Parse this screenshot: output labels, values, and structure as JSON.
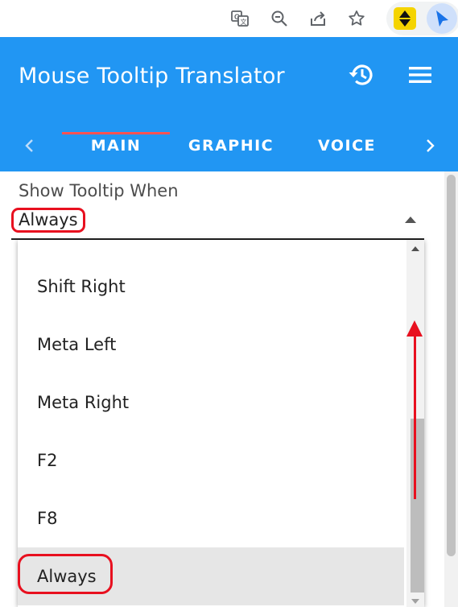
{
  "browser": {
    "icons": [
      "translate-icon",
      "zoom-out-icon",
      "share-icon",
      "bookmark-star-icon",
      "extension-arrows-icon",
      "extension-cursor-icon"
    ]
  },
  "header": {
    "title": "Mouse Tooltip Translator",
    "background": "#2196f3",
    "icons": [
      "history-icon",
      "menu-icon"
    ]
  },
  "tabs": {
    "items": [
      {
        "label": "MAIN",
        "active": true
      },
      {
        "label": "GRAPHIC",
        "active": false
      },
      {
        "label": "VOICE",
        "active": false
      }
    ],
    "indicator_color": "#ff5252"
  },
  "setting": {
    "label": "Show Tooltip When",
    "selected_value": "Always"
  },
  "dropdown": {
    "options": [
      {
        "label": "Shift Right",
        "selected": false
      },
      {
        "label": "Meta Left",
        "selected": false
      },
      {
        "label": "Meta Right",
        "selected": false
      },
      {
        "label": "F2",
        "selected": false
      },
      {
        "label": "F8",
        "selected": false
      },
      {
        "label": "Always",
        "selected": true
      }
    ]
  },
  "annotation": {
    "color": "#e8101f"
  }
}
